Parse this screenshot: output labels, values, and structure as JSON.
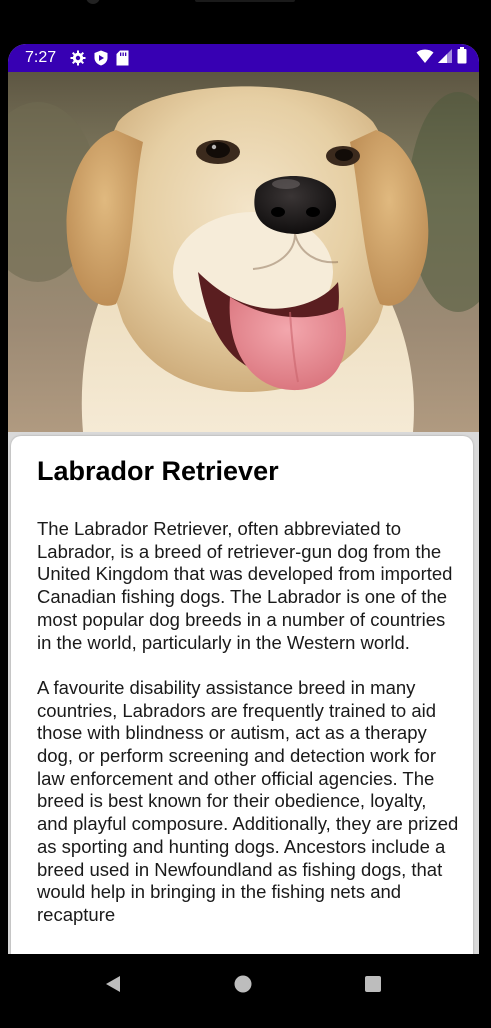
{
  "status_bar": {
    "time": "7:27",
    "left_icons": [
      "gear-icon",
      "shield-icon",
      "sd-card-icon"
    ],
    "right_icons": [
      "wifi-icon",
      "signal-icon",
      "battery-icon"
    ],
    "background_color": "#3700b3"
  },
  "hero": {
    "image": "labrador-retriever-photo"
  },
  "card": {
    "title": "Labrador Retriever",
    "paragraphs": [
      "The Labrador Retriever, often abbreviated to Labrador, is a breed of retriever-gun dog from the United Kingdom that was developed from imported Canadian fishing dogs. The Labrador is one of the most popular dog breeds in a number of countries in the world, particularly in the Western world.",
      "A favourite disability assistance breed in many countries, Labradors are frequently trained to aid those with blindness or autism, act as a therapy dog, or perform screening and detection work for law enforcement and other official agencies. The breed is best known for their obedience, loyalty, and playful composure. Additionally, they are prized as sporting and hunting dogs. Ancestors include a breed used in Newfoundland as fishing dogs, that would help in bringing in the fishing nets and recapture"
    ]
  },
  "nav_bar": {
    "icons": [
      "back-icon",
      "home-icon",
      "recents-icon"
    ]
  }
}
